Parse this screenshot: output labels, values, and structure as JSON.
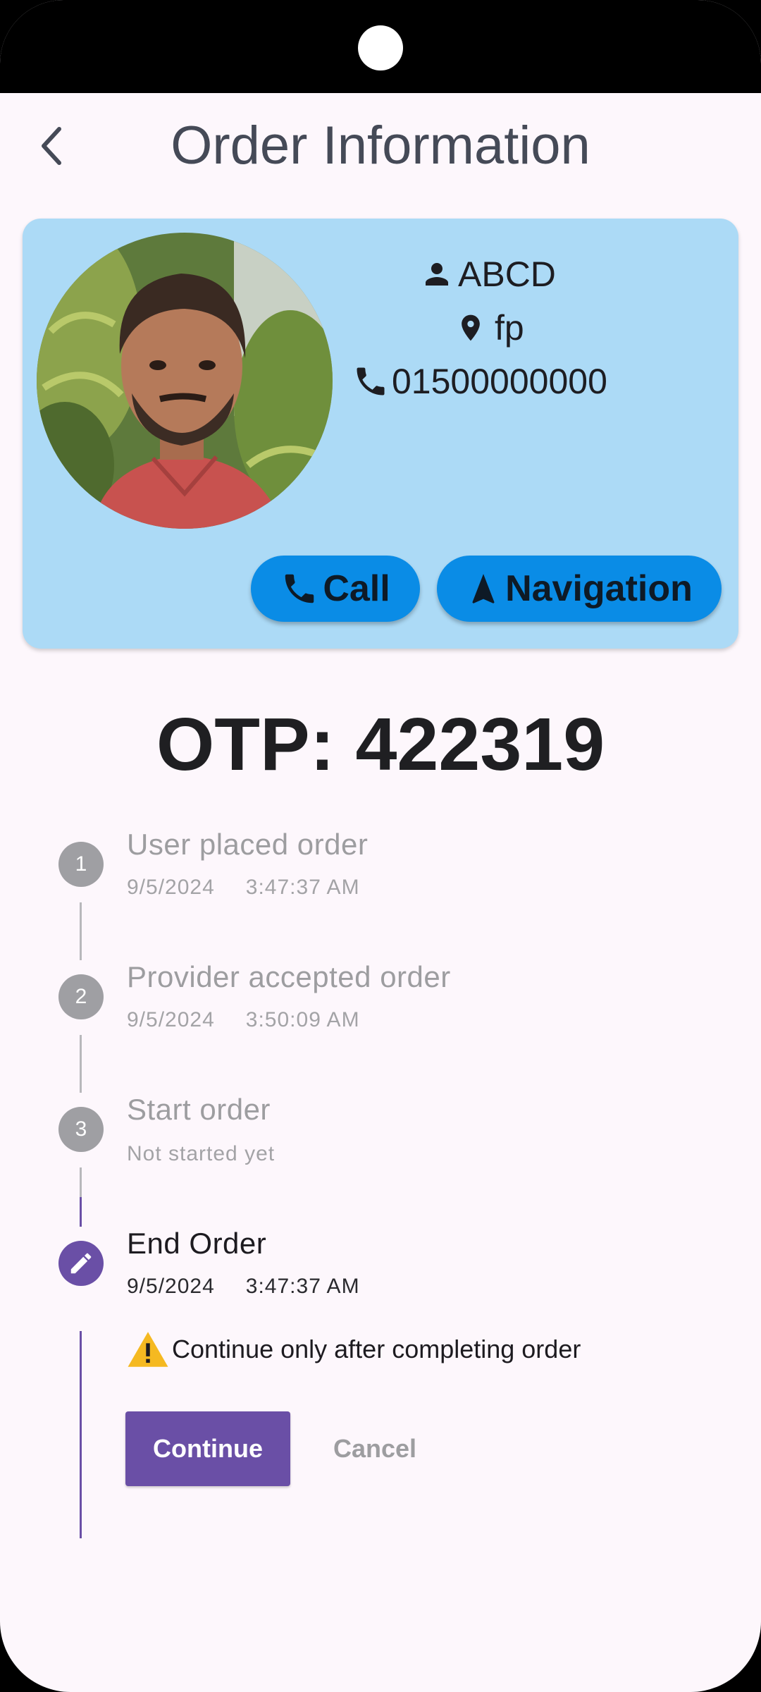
{
  "header": {
    "title": "Order Information"
  },
  "profile": {
    "name": "ABCD",
    "location": "fp",
    "phone": "01500000000",
    "call_label": "Call",
    "navigation_label": "Navigation"
  },
  "otp": "OTP: 422319",
  "steps": [
    {
      "number": "1",
      "title": "User placed order",
      "date": "9/5/2024",
      "time": "3:47:37 AM"
    },
    {
      "number": "2",
      "title": "Provider accepted order",
      "date": "9/5/2024",
      "time": "3:50:09 AM"
    },
    {
      "number": "3",
      "title": "Start order",
      "status": "Not started yet"
    },
    {
      "title": "End Order",
      "date": "9/5/2024",
      "time": "3:47:37 AM",
      "icon": "edit-icon"
    }
  ],
  "active_step": {
    "warning": "Continue only after completing order",
    "continue_label": "Continue",
    "cancel_label": "Cancel"
  },
  "colors": {
    "card_background": "#acdaf6",
    "pill_button": "#0a8ce6",
    "accent": "#6a4fa6",
    "inactive_step": "#9f9fa3",
    "warning": "#f5b921"
  }
}
